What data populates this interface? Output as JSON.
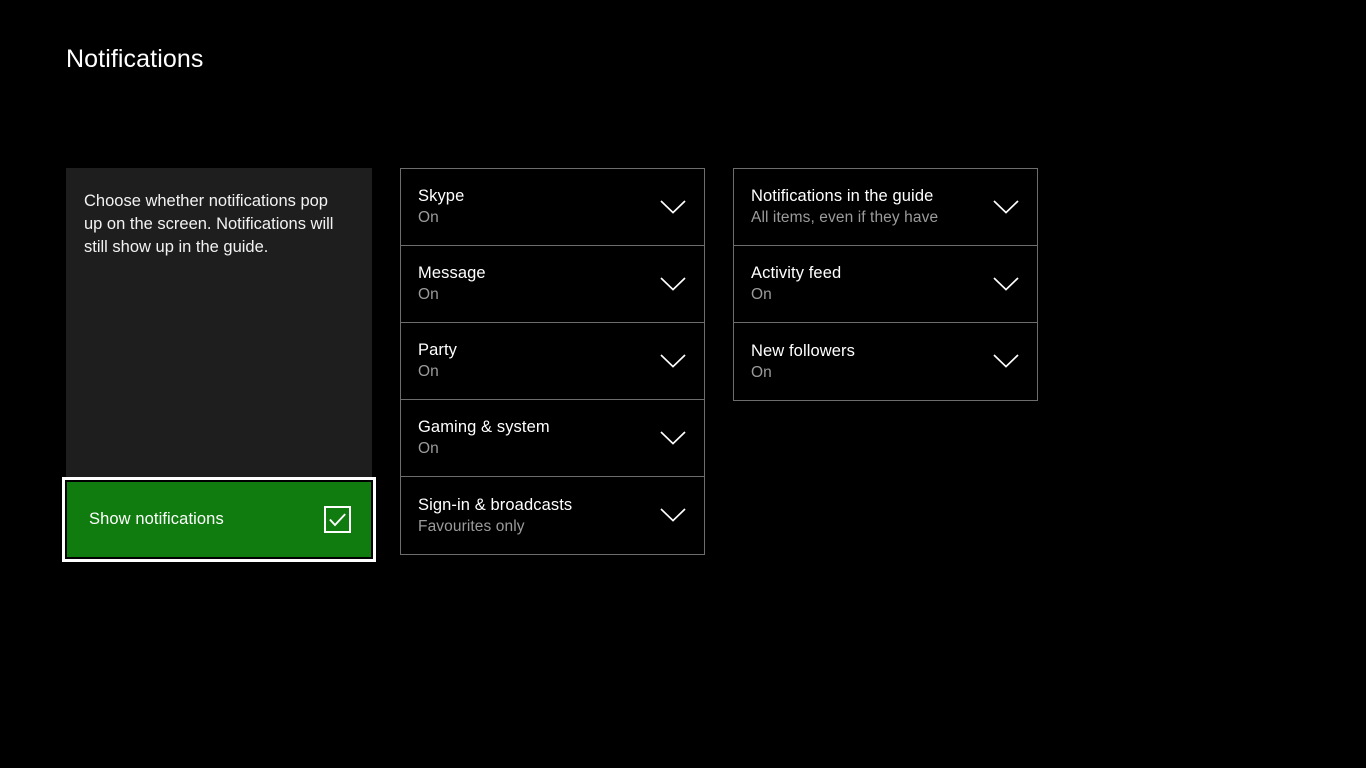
{
  "header": {
    "title": "Notifications"
  },
  "left_panel": {
    "description": "Choose whether notifications pop up on the screen. Notifications will still show up in the guide.",
    "toggle": {
      "label": "Show notifications",
      "checked": true,
      "checkbox_icon": "checkbox-checked-icon",
      "accent_color": "#107c10",
      "focus_border_color": "#ffffff"
    }
  },
  "columns": [
    {
      "id": "middle",
      "items": [
        {
          "title": "Skype",
          "value": "On",
          "icon": "chevron-down-icon"
        },
        {
          "title": "Message",
          "value": "On",
          "icon": "chevron-down-icon"
        },
        {
          "title": "Party",
          "value": "On",
          "icon": "chevron-down-icon"
        },
        {
          "title": "Gaming & system",
          "value": "On",
          "icon": "chevron-down-icon"
        },
        {
          "title": "Sign-in & broadcasts",
          "value": "Favourites only",
          "icon": "chevron-down-icon"
        }
      ]
    },
    {
      "id": "right",
      "items": [
        {
          "title": "Notifications in the guide",
          "value": "All items, even if they have",
          "icon": "chevron-down-icon"
        },
        {
          "title": "Activity feed",
          "value": "On",
          "icon": "chevron-down-icon"
        },
        {
          "title": "New followers",
          "value": "On",
          "icon": "chevron-down-icon"
        }
      ]
    }
  ],
  "theme": {
    "background": "#000000",
    "panel_background": "#1e1e1e",
    "border": "#6d6d6d",
    "text_primary": "#ffffff",
    "text_secondary": "#9b9b9b"
  }
}
